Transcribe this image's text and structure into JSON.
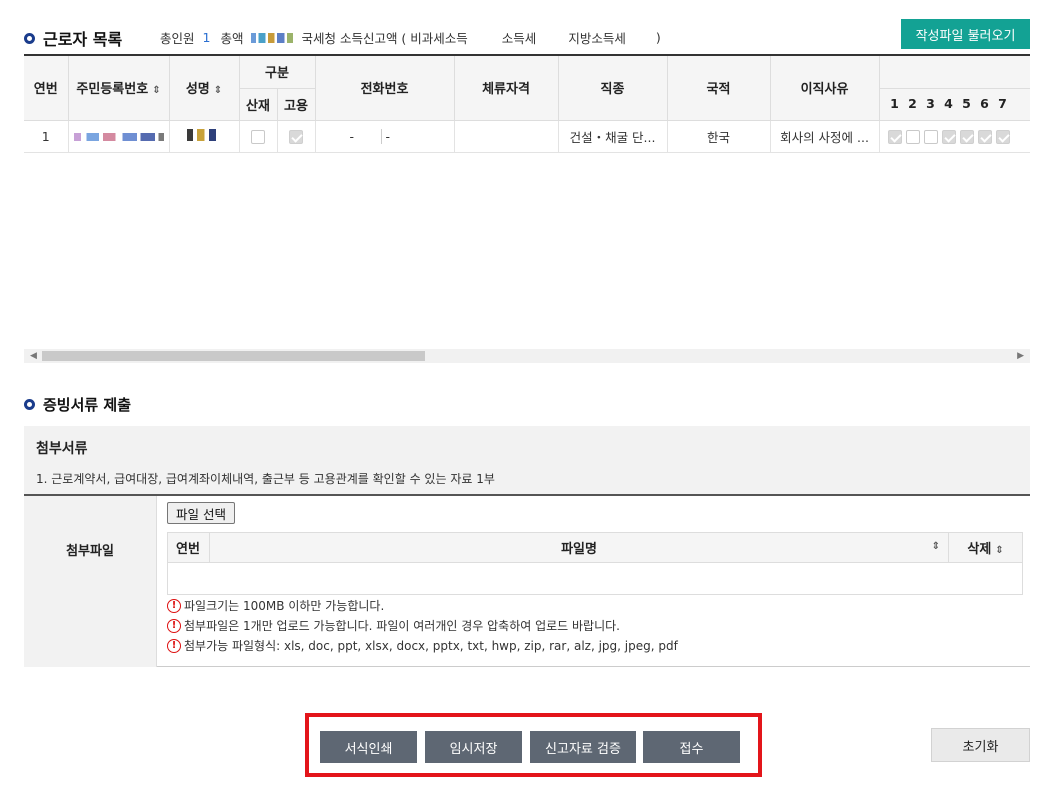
{
  "workers": {
    "title": "근로자 목록",
    "summary": {
      "total_label": "총인원",
      "total_count": "1",
      "amount_label": "총액",
      "nts_label": "국세청 소득신고액 ( 비과세소득",
      "income_tax_label": "소득세",
      "local_tax_label": "지방소득세",
      "close_paren": ")"
    },
    "load_button": "작성파일 불러오기",
    "columns": {
      "no": "연번",
      "rrn": "주민등록번호",
      "name": "성명",
      "category": "구분",
      "sanjae": "산재",
      "goyong": "고용",
      "phone": "전화번호",
      "stay": "체류자격",
      "job": "직종",
      "nationality": "국적",
      "reason": "이직사유",
      "months": [
        "1",
        "2",
        "3",
        "4",
        "5",
        "6",
        "7"
      ]
    },
    "rows": [
      {
        "no": "1",
        "phone_sep1": "-",
        "phone_sep2": "-",
        "stay": "",
        "job": "건설・채굴 단...",
        "nationality": "한국",
        "reason": "회사의 사정에 ...",
        "sanjae": false,
        "goyong": true,
        "months": [
          true,
          false,
          false,
          true,
          true,
          true,
          true
        ]
      }
    ]
  },
  "evidence": {
    "title": "증빙서류 제출",
    "attach_head": "첨부서류",
    "attach_desc": "1. 근로계약서, 급여대장, 급여계좌이체내역, 출근부 등 고용관계를 확인할 수 있는 자료 1부",
    "file_label": "첨부파일",
    "file_select": "파일 선택",
    "file_cols": {
      "no": "연번",
      "filename": "파일명",
      "delete": "삭제"
    },
    "notes": [
      "파일크기는 100MB 이하만 가능합니다.",
      "첨부파일은 1개만 업로드 가능합니다. 파일이 여러개인 경우 압축하여 업로드 바랍니다.",
      "첨부가능 파일형식: xls, doc, ppt, xlsx, docx, pptx, txt, hwp, zip, rar, alz, jpg, jpeg, pdf"
    ]
  },
  "actions": {
    "print": "서식인쇄",
    "temp_save": "임시저장",
    "verify": "신고자료 검증",
    "submit": "접수",
    "reset": "초기화"
  },
  "icons": {
    "sort": "sort-icon",
    "warning": "warning-icon",
    "bullet": "bullet-circle-icon"
  },
  "colors": {
    "accent": "#13a294",
    "action_button": "#5e6773",
    "highlight_frame": "#e3151a",
    "bullet": "#1a3c8c"
  }
}
